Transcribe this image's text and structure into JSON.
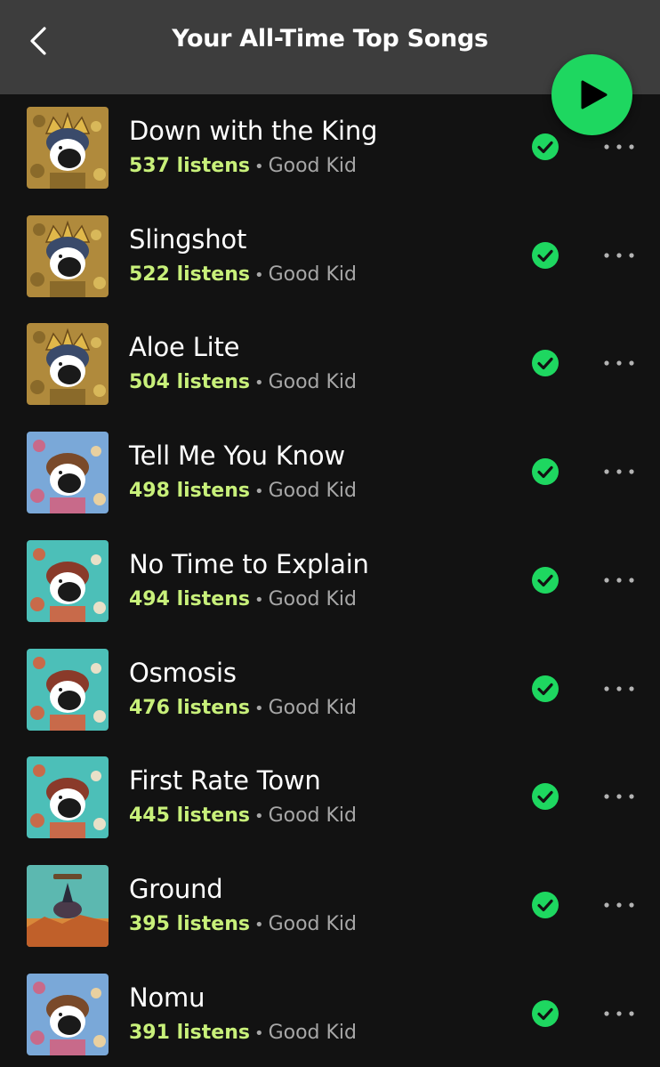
{
  "header": {
    "title": "Your All-Time Top Songs",
    "back_icon": "chevron-left-icon",
    "play_icon": "play-icon",
    "accent_color": "#1ed760"
  },
  "tracks": [
    {
      "title": "Down with the King",
      "listens": "537 listens",
      "artist": "Good Kid",
      "art": "crown",
      "downloaded": true
    },
    {
      "title": "Slingshot",
      "listens": "522 listens",
      "artist": "Good Kid",
      "art": "crown",
      "downloaded": true
    },
    {
      "title": "Aloe Lite",
      "listens": "504 listens",
      "artist": "Good Kid",
      "art": "crown",
      "downloaded": true
    },
    {
      "title": "Tell Me You Know",
      "listens": "498 listens",
      "artist": "Good Kid",
      "art": "blue",
      "downloaded": true
    },
    {
      "title": "No Time to Explain",
      "listens": "494 listens",
      "artist": "Good Kid",
      "art": "teal",
      "downloaded": true
    },
    {
      "title": "Osmosis",
      "listens": "476 listens",
      "artist": "Good Kid",
      "art": "teal",
      "downloaded": true
    },
    {
      "title": "First Rate Town",
      "listens": "445 listens",
      "artist": "Good Kid",
      "art": "teal",
      "downloaded": true
    },
    {
      "title": "Ground",
      "listens": "395 listens",
      "artist": "Good Kid",
      "art": "ground",
      "downloaded": true
    },
    {
      "title": "Nomu",
      "listens": "391 listens",
      "artist": "Good Kid",
      "art": "blue",
      "downloaded": true
    }
  ],
  "separator": "•",
  "colors": {
    "listens": "#c8f07a",
    "secondary_text": "#a7a7a7",
    "background": "#121212",
    "header_background": "#3d3d3d"
  }
}
